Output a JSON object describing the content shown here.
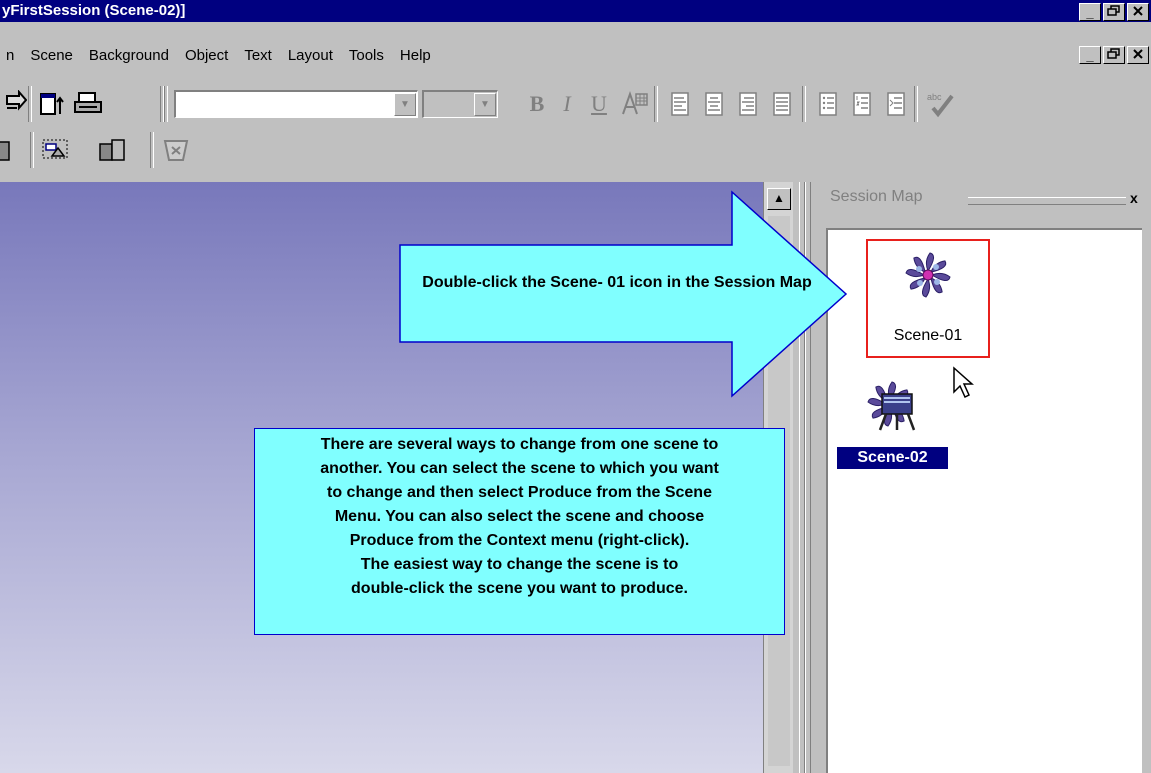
{
  "window": {
    "title": "yFirstSession (Scene-02)]",
    "buttons": [
      "_",
      "🗗",
      "✕"
    ]
  },
  "menu": {
    "items": [
      {
        "label": "n"
      },
      {
        "label": "Scene"
      },
      {
        "label": "Background"
      },
      {
        "label": "Object"
      },
      {
        "label": "Text"
      },
      {
        "label": "Layout"
      },
      {
        "label": "Tools"
      },
      {
        "label": "Help"
      }
    ]
  },
  "toolbar": {
    "font_combo_value": "",
    "size_combo_value": "",
    "bold": "B",
    "italic": "I",
    "underline": "U",
    "icons": [
      "import-icon",
      "page-icon",
      "print-icon",
      "text-style-icon",
      "align-left-icon",
      "align-center-icon",
      "align-right-icon",
      "justify-icon",
      "bullets-icon",
      "numbering-icon",
      "spellcheck-icon",
      "object-icon",
      "resize-icon",
      "copy-icon",
      "trash-icon"
    ]
  },
  "session_map": {
    "title": "Session Map",
    "close": "x",
    "scenes": [
      {
        "label": "Scene-01",
        "selected": false,
        "highlighted": true
      },
      {
        "label": "Scene-02",
        "selected": true,
        "highlighted": false
      }
    ]
  },
  "callouts": {
    "arrow_text": "Double-click the Scene- 01 icon in the Session Map",
    "note_lines": [
      "There are several ways to change from one scene to",
      "another. You can select the scene to which you want",
      "to change and then select Produce from the Scene",
      "Menu. You can also select the scene and choose",
      "Produce from the Context menu (right-click).",
      "The easiest way to change the scene is to",
      "double-click the scene you want to produce."
    ]
  },
  "colors": {
    "titlebar": "#000080",
    "callout_fill": "#80ffff",
    "highlight_border": "#e8201c"
  }
}
